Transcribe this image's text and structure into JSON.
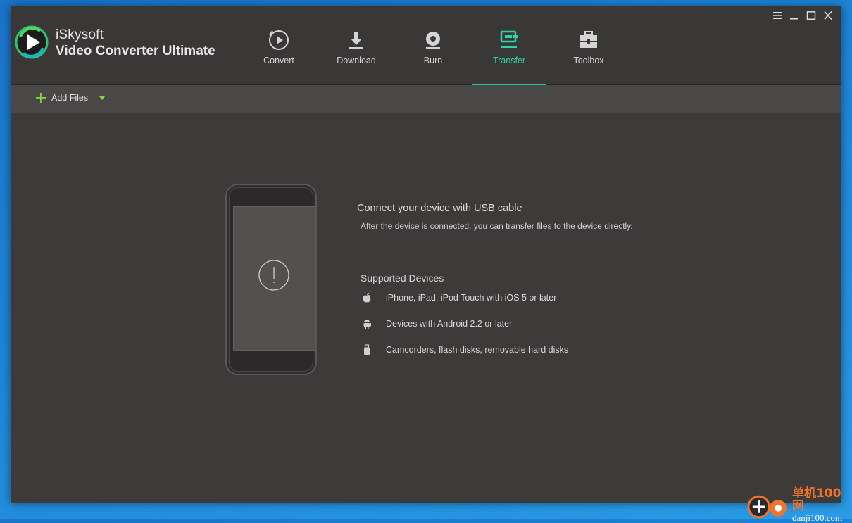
{
  "app": {
    "brand_top": "iSkysoft",
    "brand_bottom": "Video Converter Ultimate"
  },
  "window_controls": [
    {
      "name": "menu-icon"
    },
    {
      "name": "minimize-icon"
    },
    {
      "name": "maximize-icon"
    },
    {
      "name": "close-icon"
    }
  ],
  "nav": {
    "tabs": [
      {
        "label": "Convert",
        "icon": "convert-icon"
      },
      {
        "label": "Download",
        "icon": "download-icon"
      },
      {
        "label": "Burn",
        "icon": "burn-icon"
      },
      {
        "label": "Transfer",
        "icon": "transfer-icon",
        "active": true
      },
      {
        "label": "Toolbox",
        "icon": "toolbox-icon"
      }
    ]
  },
  "toolbar": {
    "add_files_label": "Add Files"
  },
  "main": {
    "connect_title": "Connect your device with USB cable",
    "connect_sub": "After the device is connected, you can transfer files to the device directly.",
    "supported_title": "Supported Devices",
    "devices": [
      {
        "icon": "apple-icon",
        "label": "iPhone, iPad, iPod Touch with iOS 5 or later"
      },
      {
        "icon": "android-icon",
        "label": "Devices with Android 2.2 or later"
      },
      {
        "icon": "usb-drive-icon",
        "label": "Camcorders, flash disks, removable hard disks"
      }
    ]
  },
  "watermark": {
    "cn": "单机100网",
    "en": "danji100.com"
  },
  "colors": {
    "accent": "#29d6a5",
    "add_green": "#8ad33a",
    "background": "#3d3a3a",
    "titlebar": "#3a3737",
    "toolbar": "#4a4747"
  }
}
